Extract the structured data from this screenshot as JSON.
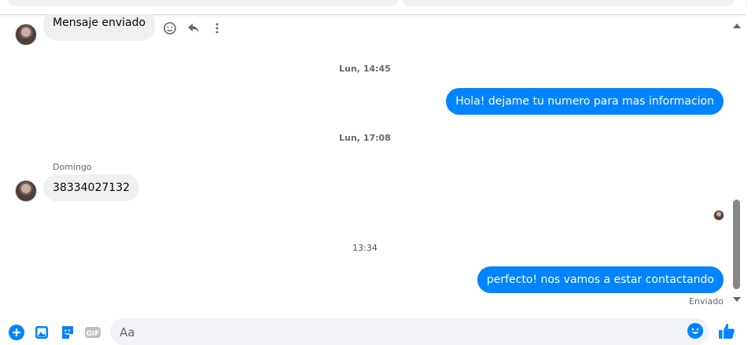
{
  "messages": {
    "first_incoming": "Mensaje enviado",
    "time1": "Lun, 14:45",
    "out1": "Hola! dejame tu numero para mas informacion",
    "time2": "Lun, 17:08",
    "sender": "Domingo",
    "in2": "38334027132",
    "time3": "13:34",
    "out2": "perfecto! nos vamos a estar contactando",
    "status": "Enviado"
  },
  "composer": {
    "placeholder": "Aa"
  },
  "icons": {
    "actions": [
      "emoji-react-icon",
      "reply-icon",
      "more-icon"
    ],
    "composer": [
      "plus-icon",
      "image-icon",
      "sticker-icon",
      "gif-icon",
      "emoji-icon",
      "thumbs-up-icon"
    ]
  },
  "colors": {
    "accent": "#0084ff",
    "incoming_bubble": "#f0f0f0",
    "timestamp": "#65676b"
  }
}
